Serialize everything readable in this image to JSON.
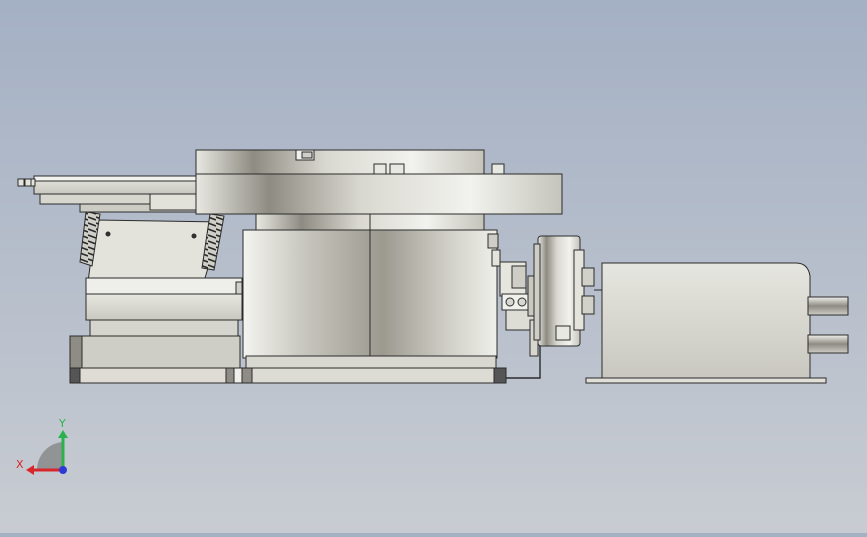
{
  "view": {
    "background_top": "#a4b0c4",
    "background_bottom": "#c8ccd2",
    "part_stroke": "#2b2b2b"
  },
  "axis_triad": {
    "x_label": "X",
    "y_label": "Y",
    "x_color": "#d8262a",
    "y_color": "#2bb24c",
    "z_color": "#2d3ad6"
  },
  "assembly": {
    "components": [
      "left-slide-table",
      "spring-column",
      "left-base-block",
      "rotary-table-top",
      "rotary-drum-housing",
      "base-plate",
      "encoder-bracket",
      "motor-flange",
      "servo-motor",
      "motor-shafts"
    ]
  }
}
